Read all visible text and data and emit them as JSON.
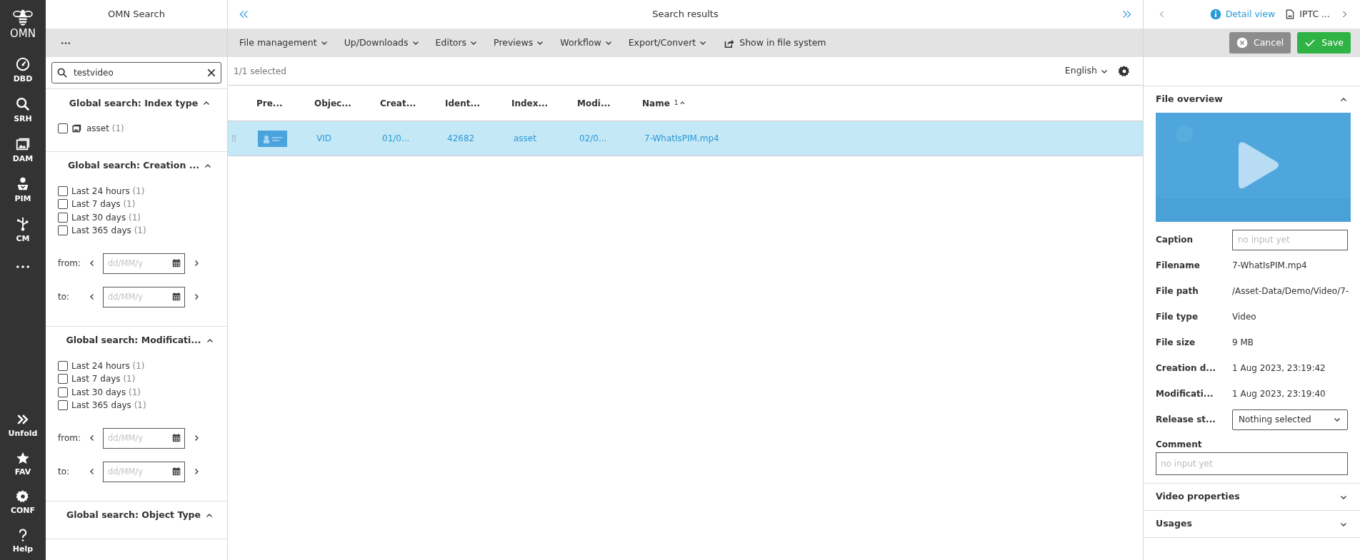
{
  "nav": {
    "logo": "OMN",
    "items": [
      {
        "label": "DBD"
      },
      {
        "label": "SRH"
      },
      {
        "label": "DAM"
      },
      {
        "label": "PIM"
      },
      {
        "label": "CM"
      }
    ],
    "bottom_items": [
      {
        "label": "Unfold"
      },
      {
        "label": "FAV"
      },
      {
        "label": "CONF"
      },
      {
        "label": "Help"
      }
    ]
  },
  "filter_panel": {
    "title": "OMN Search",
    "search": {
      "value": "testvideo"
    },
    "sections": [
      {
        "kind": "list",
        "title": "Global search: Index type",
        "expanded": true,
        "options": [
          {
            "label": "asset",
            "count": "(1)",
            "checked": false
          }
        ]
      },
      {
        "kind": "dates",
        "title": "Global search: Creation ...",
        "expanded": true,
        "options": [
          {
            "label": "Last 24 hours",
            "count": "(1)",
            "checked": false
          },
          {
            "label": "Last 7 days",
            "count": "(1)",
            "checked": false
          },
          {
            "label": "Last 30 days",
            "count": "(1)",
            "checked": false
          },
          {
            "label": "Last 365 days",
            "count": "(1)",
            "checked": false
          }
        ],
        "ranges": [
          {
            "label": "from:",
            "placeholder": "dd/MM/y"
          },
          {
            "label": "to:",
            "placeholder": "dd/MM/y"
          }
        ]
      },
      {
        "kind": "dates",
        "title": "Global search: Modificati...",
        "expanded": true,
        "options": [
          {
            "label": "Last 24 hours",
            "count": "(1)",
            "checked": false
          },
          {
            "label": "Last 7 days",
            "count": "(1)",
            "checked": false
          },
          {
            "label": "Last 30 days",
            "count": "(1)",
            "checked": false
          },
          {
            "label": "Last 365 days",
            "count": "(1)",
            "checked": false
          }
        ],
        "ranges": [
          {
            "label": "from:",
            "placeholder": "dd/MM/y"
          },
          {
            "label": "to:",
            "placeholder": "dd/MM/y"
          }
        ]
      },
      {
        "kind": "list",
        "title": "Global search: Object Type",
        "expanded": true
      }
    ]
  },
  "results": {
    "title": "Search results",
    "menus": [
      "File management",
      "Up/Downloads",
      "Editors",
      "Previews",
      "Workflow",
      "Export/Convert"
    ],
    "action": "Show in file system",
    "selection": "1/1 selected",
    "language": "English",
    "columns": [
      {
        "label": "Pre..."
      },
      {
        "label": "Objec..."
      },
      {
        "label": "Creat..."
      },
      {
        "label": "Ident..."
      },
      {
        "label": "Index..."
      },
      {
        "label": "Modi..."
      },
      {
        "label": "Name",
        "sort_index": "1",
        "sorted_ascending": true
      }
    ],
    "rows": [
      {
        "selected": true,
        "cells": [
          "",
          "VID",
          "01/0...",
          "42682",
          "asset",
          "02/0...",
          "7-WhatIsPIM.mp4"
        ]
      }
    ]
  },
  "detail": {
    "tabs": [
      {
        "label": "Detail view",
        "selected": true
      },
      {
        "label": "IPTC ...",
        "selected": false
      }
    ],
    "buttons": [
      {
        "label": "Cancel",
        "kind": "cancel"
      },
      {
        "label": "Save",
        "kind": "save"
      }
    ],
    "sections": [
      {
        "title": "File overview",
        "expanded": true,
        "fields": [
          {
            "kind": "input",
            "label": "Caption",
            "placeholder": "no input yet"
          },
          {
            "kind": "text",
            "label": "Filename",
            "value": "7-WhatIsPIM.mp4"
          },
          {
            "kind": "text",
            "label": "File path",
            "value": "/Asset-Data/Demo/Video/7-"
          },
          {
            "kind": "text",
            "label": "File type",
            "value": "Video"
          },
          {
            "kind": "text",
            "label": "File size",
            "value": "9 MB"
          },
          {
            "kind": "text",
            "label": "Creation d...",
            "value": "1 Aug 2023, 23:19:42"
          },
          {
            "kind": "text",
            "label": "Modificati...",
            "value": "1 Aug 2023, 23:19:40"
          },
          {
            "kind": "select",
            "label": "Release st...",
            "value": "Nothing selected"
          },
          {
            "kind": "textarea",
            "label": "Comment",
            "placeholder": "no input yet"
          }
        ]
      },
      {
        "title": "Video properties",
        "expanded": false
      },
      {
        "title": "Usages",
        "expanded": false
      }
    ]
  }
}
